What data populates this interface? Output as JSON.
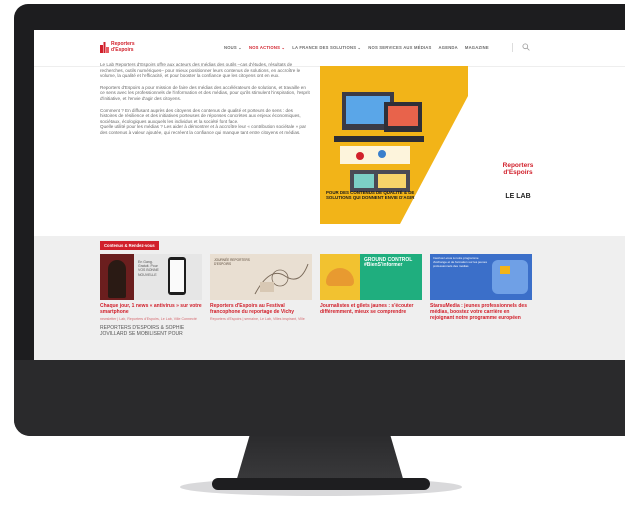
{
  "nav": {
    "logo_line1": "Reporters",
    "logo_line2": "d'Espoirs",
    "items": [
      {
        "label": "NOUS ⌄"
      },
      {
        "label": "NOS ACTIONS ⌄"
      },
      {
        "label": "LA FRANCE DES SOLUTIONS ⌄"
      },
      {
        "label": "NOS SERVICES AUX MÉDIAS"
      },
      {
        "label": "AGENDA"
      },
      {
        "label": "MAGAZINE"
      }
    ]
  },
  "intro": {
    "p1": "Le Lab Reporters d'Espoirs offre aux acteurs des médias des outils –cas d'études, résultats de recherches, outils numériques– pour mieux positionner leurs contenus de solutions, en accroître le volume, la qualité et l'efficacité, et pour booster la confiance que les citoyens ont en eux.",
    "p2": "Reporters d'Espoirs a pour mission de faire des médias des accélérateurs de solutions, et travaille en ce sens avec les professionnels de l'information et des médias, pour qu'ils stimulent l'inspiration, l'esprit d'initiative, et l'envie d'agir des citoyens.",
    "p3": "Comment ? En diffusant auprès des citoyens des contenus de qualité et porteurs de sens : des histoires de résilience et des initiatives porteuses de réponses concrètes aux enjeux économiques, sociétaux, écologiques auxquels les individus et la société font face.",
    "p4": "Quelle utilité pour les médias ? Les aider à démontrer et à accroître leur « contribution sociétale » par des contenus à valeur ajoutée, qui recréent la confiance qui manque tant entre citoyens et médias."
  },
  "hero": {
    "brand_line1": "Reporters",
    "brand_line2": "d'Espoirs",
    "lab": "LE LAB",
    "caption": "POUR DES CONTENUS DE QUALITÉ & DE SOLUTIONS QUI DONNENT ENVIE D'AGIR"
  },
  "section": {
    "badge": "Contenus & Rendez-vous",
    "cards": [
      {
        "title": "Chaque jour, 1 news « antivirus » sur votre smartphone",
        "meta": "newsletter | Lab, Reporters d'Espoirs, Le Lab, Ville Connecté",
        "extra": "REPORTERS D'ESPOIRS & SOPHIE JOVILLARD SE MOBILISENT POUR",
        "img_text": "En Gang. Gratuit. Pour VOS BONNE NOUVELLE"
      },
      {
        "title": "Reporters d'Espoirs au Festival francophone du reportage de Vichy",
        "meta": "Reporters d'Espoirs | semaine, Le Lab, Villes inspirant, Ville",
        "extra": "",
        "img_text": "JOURNÉE REPORTERS D'ESPOIRS"
      },
      {
        "title": "Journalistes et gilets jaunes : s'écouter différemment, mieux se comprendre",
        "meta": "",
        "extra": "",
        "img_text": "GROUND CONTROL #BienS'informer"
      },
      {
        "title": "StarsuMedia : jeunes professionnels des médias, boostez votre carrière en rejoignant notre programme européen",
        "meta": "",
        "extra": "",
        "img_text": "Inscrivez-vous à notre programme d'échange et de formation sur les jeunes professionnels des médias"
      }
    ]
  },
  "colors": {
    "brand_red": "#d1202b",
    "hero_yellow": "#f2b418",
    "ground_green": "#1fae7e"
  }
}
